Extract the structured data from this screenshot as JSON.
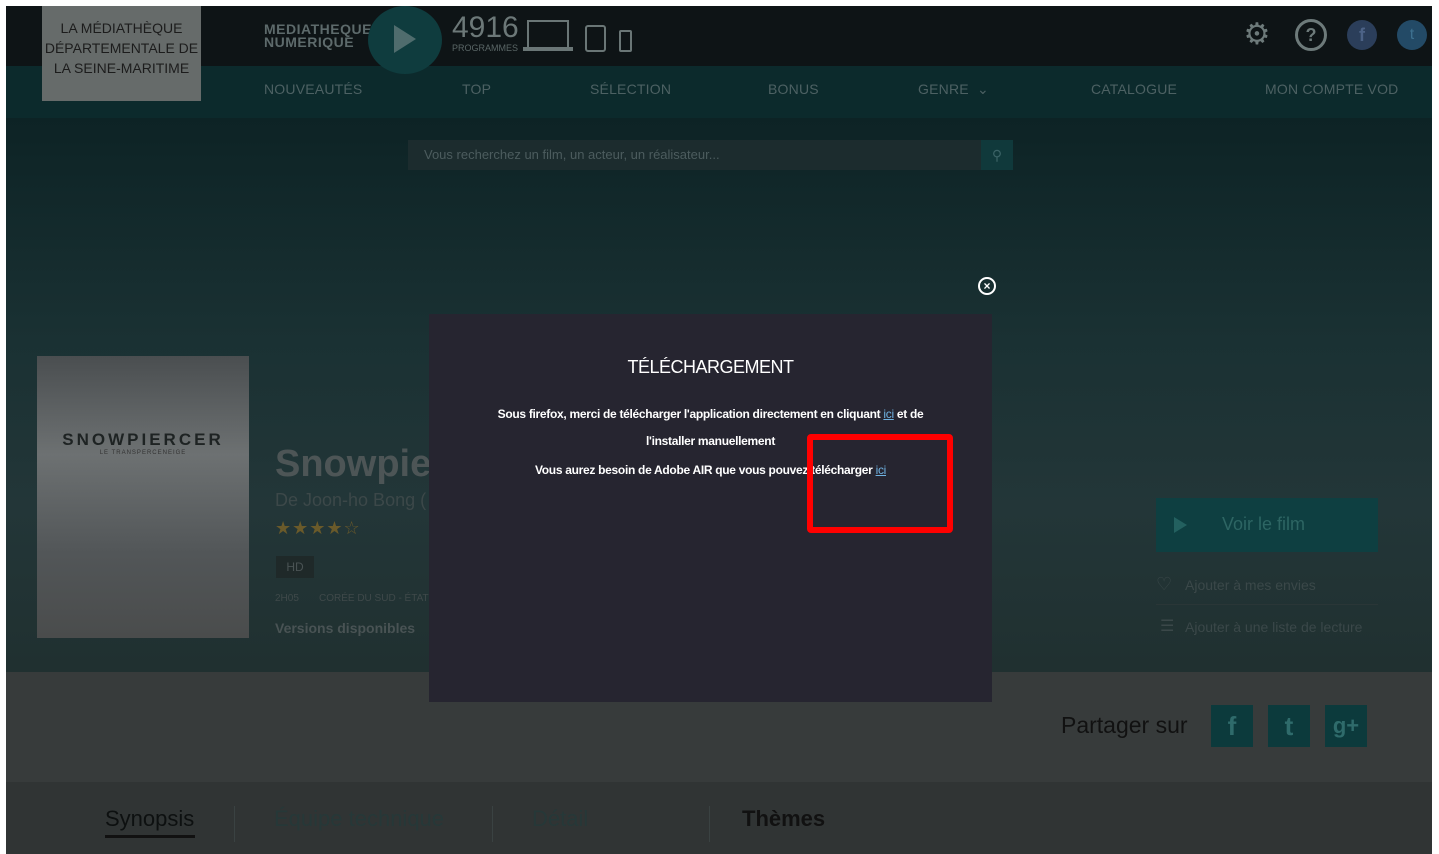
{
  "header": {
    "library_name": "LA MÉDIATHÈQUE DÉPARTEMENTALE DE LA SEINE-MARITIME",
    "brand_line1": "MEDIATHEQUE",
    "brand_line2": "NUMERIQUE",
    "program_count": "4916",
    "program_label": "PROGRAMMES",
    "icons": [
      "play-icon",
      "laptop-icon",
      "tablet-icon",
      "phone-icon",
      "gear-icon",
      "help-icon",
      "facebook-icon",
      "twitter-icon"
    ]
  },
  "nav": {
    "items": [
      "NOUVEAUTÉS",
      "TOP",
      "SÉLECTION",
      "BONUS",
      "GENRE",
      "CATALOGUE",
      "MON COMPTE VOD"
    ]
  },
  "search": {
    "placeholder": "Vous recherchez un film, un acteur, un réalisateur..."
  },
  "film": {
    "poster_title": "SNOWPIERCER",
    "poster_subtitle": "LE TRANSPERCENEIGE",
    "title": "Snowpier",
    "director": "De Joon-ho Bong (",
    "stars": "★★★★☆",
    "quality": "HD",
    "duration": "2H05",
    "countries": "CORÉE DU SUD - ÉTAT",
    "versions_label": "Versions disponibles"
  },
  "actions": {
    "watch": "Voir le film",
    "wishlist": "Ajouter à mes envies",
    "playlist": "Ajouter à une liste de lecture"
  },
  "share": {
    "label": "Partager sur",
    "networks": [
      "f",
      "t",
      "g+"
    ]
  },
  "tabs": [
    "Synopsis",
    "Équipe technique",
    "Détail",
    "Thèmes"
  ],
  "modal": {
    "title": "TÉLÉCHARGEMENT",
    "line1_prefix": "Sous firefox, merci de télécharger l'application directement en cliquant ",
    "line1_link": "ici",
    "line1_suffix": " et de",
    "line2": "l'installer manuellement",
    "line3_prefix": "Vous aurez besoin de Adobe AIR que vous pouvez télécharger ",
    "line3_link": "ici",
    "close": "×"
  },
  "colors": {
    "modal_bg": "#262530",
    "highlight": "#ff0000",
    "accent": "#0e3f41"
  }
}
